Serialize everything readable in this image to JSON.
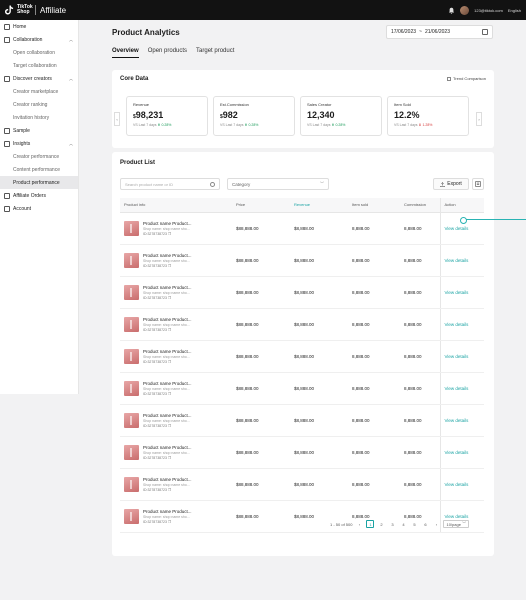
{
  "topbar": {
    "logo_text": "TikTok Shop",
    "product": "Affiliate",
    "email": "123@tiktok.com",
    "language": "English"
  },
  "sidebar": {
    "home": "Home",
    "collaboration": {
      "label": "Collaboration",
      "items": [
        "Open collaboration",
        "Target collaboration"
      ]
    },
    "discover": {
      "label": "Discover creators",
      "items": [
        "Creator marketplace",
        "Creator ranking",
        "Invitation history"
      ]
    },
    "sample": "Sample",
    "insights": {
      "label": "Insights",
      "items": [
        "Creator performance",
        "Content performance",
        "Product performance"
      ]
    },
    "affiliate_orders": "Affiliate Orders",
    "account": "Account"
  },
  "page": {
    "title": "Product Analytics",
    "date_start": "17/06/2023",
    "date_sep": "~",
    "date_end": "21/06/2023"
  },
  "tabs": [
    "Overview",
    "Open products",
    "Target product"
  ],
  "core_data": {
    "title": "Core Data",
    "trend_label": "Trend Comparison",
    "prev_arrow": "‹",
    "next_arrow": "›",
    "metrics": [
      {
        "label": "Revenue",
        "currency": "$",
        "value": "98,231",
        "vs": "VS Last 7 days",
        "change": "0.28%",
        "dir": "up"
      },
      {
        "label": "Est.Commission",
        "currency": "$",
        "value": "982",
        "vs": "VS Last 7 days",
        "change": "0.28%",
        "dir": "up"
      },
      {
        "label": "Sales Creator",
        "currency": "",
        "value": "12,340",
        "vs": "VS Last 7 days",
        "change": "0.28%",
        "dir": "up"
      },
      {
        "label": "Item Sold",
        "currency": "",
        "value": "12.2%",
        "vs": "VS Last 7 days",
        "change": "1.28%",
        "dir": "down"
      }
    ]
  },
  "product_list": {
    "title": "Product List",
    "search_placeholder": "Search product name or ID",
    "category_placeholder": "Category",
    "export_label": "Export",
    "columns": [
      "Product info",
      "Price",
      "Revenue",
      "Item sold",
      "Commission",
      "Action"
    ],
    "rows": [
      {
        "name": "Product name Product...",
        "shop": "Shop name: shop name sho...",
        "id": "ID:3278738723",
        "price": "$88,888.00",
        "revenue": "$8,888.00",
        "sold": "8,888.00",
        "commission": "8,888.00",
        "action": "View details"
      },
      {
        "name": "Product name Product...",
        "shop": "Shop name: shop name sho...",
        "id": "ID:3278738723",
        "price": "$88,888.00",
        "revenue": "$8,888.00",
        "sold": "8,888.00",
        "commission": "8,888.00",
        "action": "View details"
      },
      {
        "name": "Product name Product...",
        "shop": "Shop name: shop name sho...",
        "id": "ID:3278738723",
        "price": "$88,888.00",
        "revenue": "$8,888.00",
        "sold": "8,888.00",
        "commission": "8,888.00",
        "action": "View details"
      },
      {
        "name": "Product name Product...",
        "shop": "Shop name: shop name sho...",
        "id": "ID:3278738723",
        "price": "$88,888.00",
        "revenue": "$8,888.00",
        "sold": "8,888.00",
        "commission": "8,888.00",
        "action": "View details"
      },
      {
        "name": "Product name Product...",
        "shop": "Shop name: shop name sho...",
        "id": "ID:3278738723",
        "price": "$88,888.00",
        "revenue": "$8,888.00",
        "sold": "8,888.00",
        "commission": "8,888.00",
        "action": "View details"
      },
      {
        "name": "Product name Product...",
        "shop": "Shop name: shop name sho...",
        "id": "ID:3278738723",
        "price": "$88,888.00",
        "revenue": "$8,888.00",
        "sold": "8,888.00",
        "commission": "8,888.00",
        "action": "View details"
      },
      {
        "name": "Product name Product...",
        "shop": "Shop name: shop name sho...",
        "id": "ID:3278738723",
        "price": "$88,888.00",
        "revenue": "$8,888.00",
        "sold": "8,888.00",
        "commission": "8,888.00",
        "action": "View details"
      },
      {
        "name": "Product name Product...",
        "shop": "Shop name: shop name sho...",
        "id": "ID:3278738723",
        "price": "$88,888.00",
        "revenue": "$8,888.00",
        "sold": "8,888.00",
        "commission": "8,888.00",
        "action": "View details"
      },
      {
        "name": "Product name Product...",
        "shop": "Shop name: shop name sho...",
        "id": "ID:3278738723",
        "price": "$88,888.00",
        "revenue": "$8,888.00",
        "sold": "8,888.00",
        "commission": "8,888.00",
        "action": "View details"
      },
      {
        "name": "Product name Product...",
        "shop": "Shop name: shop name sho...",
        "id": "ID:3278738723",
        "price": "$88,888.00",
        "revenue": "$8,888.00",
        "sold": "8,888.00",
        "commission": "8,888.00",
        "action": "View details"
      }
    ]
  },
  "pagination": {
    "summary": "1 - 50 of 500",
    "prev": "‹",
    "pages": [
      "1",
      "2",
      "3",
      "4",
      "5",
      "6"
    ],
    "next": "›",
    "per_page": "10/page"
  },
  "colors": {
    "accent": "#1aa3a3",
    "up": "#1b9b5a",
    "down": "#d63b3b"
  }
}
